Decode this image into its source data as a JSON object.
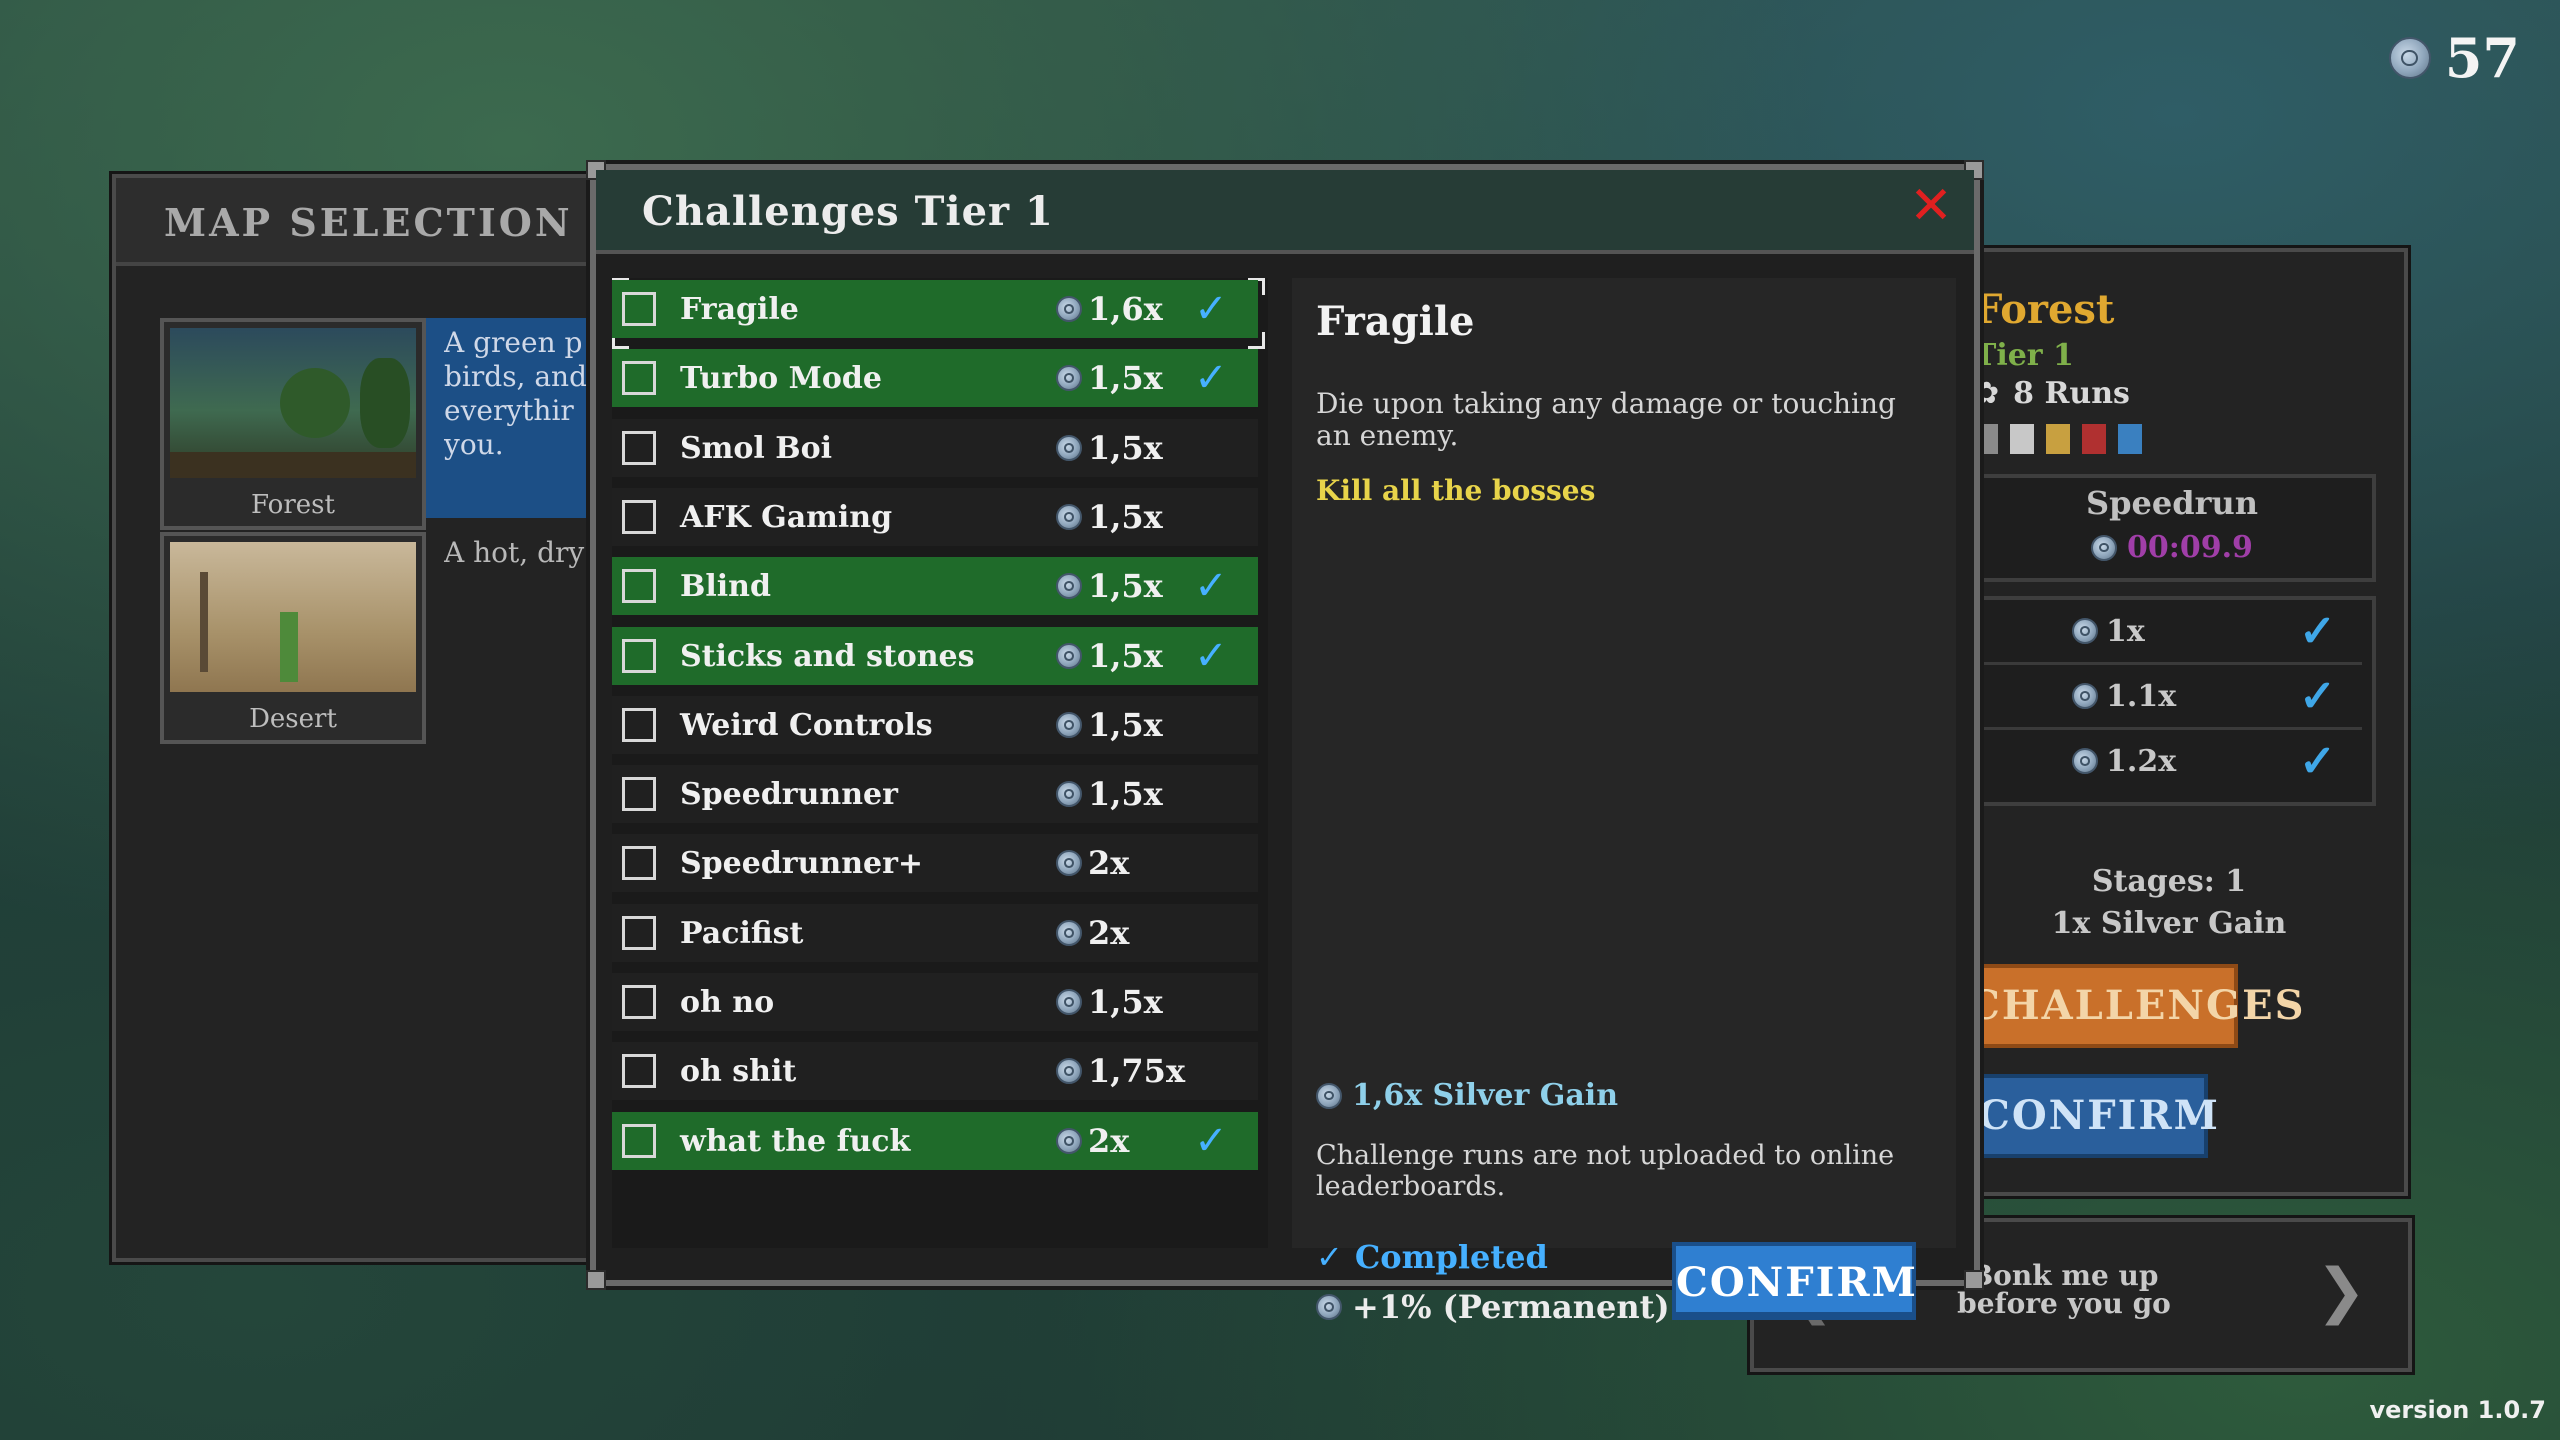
{
  "currency": {
    "icon": "silver-coin-icon",
    "amount": "57"
  },
  "map_selection": {
    "title": "MAP SELECTION",
    "maps": [
      {
        "name": "Forest",
        "description": "A green p birds, and everythir you."
      },
      {
        "name": "Desert",
        "description": "A hot, dry"
      }
    ]
  },
  "right_panel": {
    "map_name": "Forest",
    "tier": "Tier 1",
    "runs": "8 Runs",
    "speedrun_label": "Speedrun",
    "speedrun_time": "00:09.9",
    "tiers": [
      {
        "mult": "1x",
        "done": true
      },
      {
        "mult": "1.1x",
        "done": true
      },
      {
        "mult": "1.2x",
        "done": true
      }
    ],
    "stages": "Stages: 1",
    "silver_gain": "1x Silver Gain",
    "challenges_button": "CHALLENGES",
    "confirm_button": "CONFIRM"
  },
  "music": {
    "track": "Bonk me up before you go"
  },
  "dialog": {
    "title": "Challenges Tier 1",
    "close_icon": "close-x-icon",
    "challenges": [
      {
        "name": "Fragile",
        "mult": "1,6x",
        "completed": true
      },
      {
        "name": "Turbo Mode",
        "mult": "1,5x",
        "completed": true
      },
      {
        "name": "Smol Boi",
        "mult": "1,5x",
        "completed": false
      },
      {
        "name": "AFK Gaming",
        "mult": "1,5x",
        "completed": false
      },
      {
        "name": "Blind",
        "mult": "1,5x",
        "completed": true
      },
      {
        "name": "Sticks and stones",
        "mult": "1,5x",
        "completed": true
      },
      {
        "name": "Weird Controls",
        "mult": "1,5x",
        "completed": false
      },
      {
        "name": "Speedrunner",
        "mult": "1,5x",
        "completed": false
      },
      {
        "name": "Speedrunner+",
        "mult": "2x",
        "completed": false
      },
      {
        "name": "Pacifist",
        "mult": "2x",
        "completed": false
      },
      {
        "name": "oh no",
        "mult": "1,5x",
        "completed": false
      },
      {
        "name": "oh shit",
        "mult": "1,75x",
        "completed": false
      },
      {
        "name": "what the fuck",
        "mult": "2x",
        "completed": true
      }
    ],
    "detail": {
      "title": "Fragile",
      "description": "Die upon taking any damage or touching an enemy.",
      "goal": "Kill all the bosses",
      "silver_gain": "1,6x Silver Gain",
      "note": "Challenge runs are not uploaded to online leaderboards.",
      "completed_label": "Completed",
      "permanent_bonus": "+1% (Permanent)",
      "confirm_label": "CONFIRM"
    }
  },
  "version": "version 1.0.7",
  "colors": {
    "active_row": "#1f6b2a",
    "check": "#46b0ff",
    "goal": "#e8d44a",
    "confirm": "#2f7fd1"
  }
}
